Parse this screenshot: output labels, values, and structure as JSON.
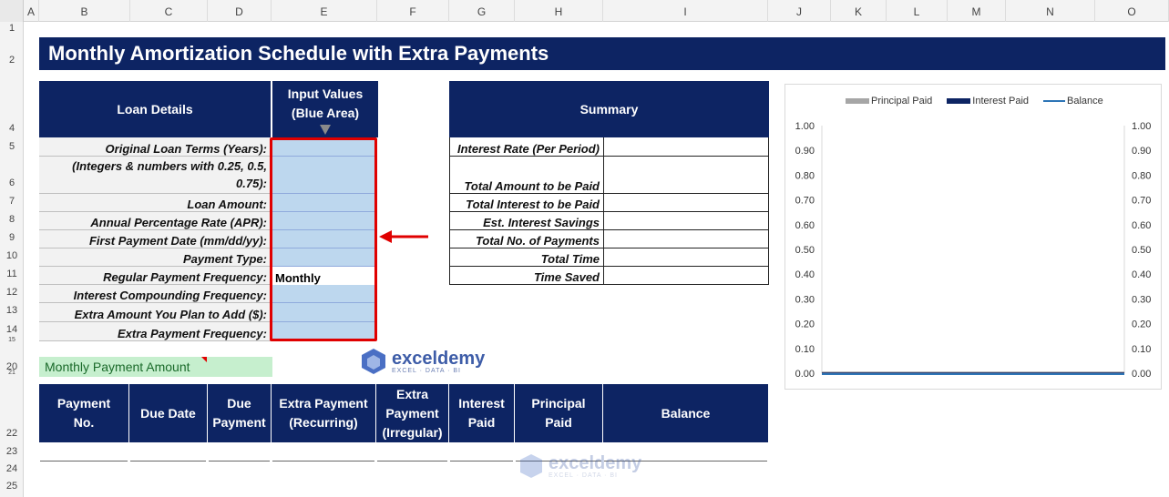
{
  "sheet": {
    "columns": [
      "A",
      "B",
      "C",
      "D",
      "E",
      "F",
      "G",
      "H",
      "I",
      "J",
      "K",
      "L",
      "M",
      "N",
      "O"
    ],
    "rows": [
      "1",
      "2",
      "4",
      "5",
      "6",
      "7",
      "8",
      "9",
      "10",
      "11",
      "12",
      "13",
      "14",
      "15",
      "20",
      "21",
      "22",
      "23",
      "24",
      "25"
    ]
  },
  "title": "Monthly Amortization Schedule with Extra Payments",
  "loan": {
    "header_left": "Loan Details",
    "header_right_line1": "Input Values",
    "header_right_line2": "(Blue Area)",
    "rows": [
      {
        "label": "Original Loan Terms (Years):",
        "value": ""
      },
      {
        "label": "(Integers & numbers with 0.25, 0.5,",
        "label2": "0.75):",
        "value": ""
      },
      {
        "label": "Loan Amount:",
        "value": ""
      },
      {
        "label": "Annual Percentage Rate (APR):",
        "value": ""
      },
      {
        "label": "First Payment Date (mm/dd/yy):",
        "value": ""
      },
      {
        "label": "Payment Type:",
        "value": ""
      },
      {
        "label": "Regular Payment Frequency:",
        "value": "Monthly"
      },
      {
        "label": "Interest Compounding Frequency:",
        "value": ""
      },
      {
        "label": "Extra Amount You Plan to Add ($):",
        "value": ""
      },
      {
        "label": "Extra Payment Frequency:",
        "value": ""
      }
    ]
  },
  "summary": {
    "header": "Summary",
    "rows": [
      {
        "label": "Interest Rate (Per Period)",
        "value": ""
      },
      {
        "label": "Total Amount to be Paid",
        "value": ""
      },
      {
        "label": "Total Interest to be Paid",
        "value": ""
      },
      {
        "label": "Est. Interest Savings",
        "value": ""
      },
      {
        "label": "Total No. of Payments",
        "value": ""
      },
      {
        "label": "Total Time",
        "value": ""
      },
      {
        "label": "Time Saved",
        "value": ""
      }
    ]
  },
  "monthly_payment_label": "Monthly Payment Amount",
  "schedule": {
    "headers": [
      {
        "l1": "Payment",
        "l2": "No."
      },
      {
        "l1": "Due Date",
        "l2": ""
      },
      {
        "l1": "Due",
        "l2": "Payment"
      },
      {
        "l1": "Extra Payment",
        "l2": "(Recurring)"
      },
      {
        "l1": "Extra",
        "l2": "Payment",
        "l3": "(Irregular)"
      },
      {
        "l1": "Interest",
        "l2": "Paid"
      },
      {
        "l1": "Principal",
        "l2": "Paid"
      },
      {
        "l1": "Balance",
        "l2": ""
      }
    ]
  },
  "watermark": {
    "name": "exceldemy",
    "tagline": "EXCEL · DATA · BI"
  },
  "chart_data": {
    "type": "bar",
    "series": [
      {
        "name": "Principal Paid",
        "values": [
          0
        ],
        "color": "#a6a6a6"
      },
      {
        "name": "Interest Paid",
        "values": [
          0
        ],
        "color": "#0d2463"
      },
      {
        "name": "Balance",
        "values": [
          0
        ],
        "color": "#2e75b6"
      }
    ],
    "yticks_left": [
      "1.00",
      "0.90",
      "0.80",
      "0.70",
      "0.60",
      "0.50",
      "0.40",
      "0.30",
      "0.20",
      "0.10",
      "0.00"
    ],
    "yticks_right": [
      "1.00",
      "0.90",
      "0.80",
      "0.70",
      "0.60",
      "0.50",
      "0.40",
      "0.30",
      "0.20",
      "0.10",
      "0.00"
    ],
    "ylim": [
      0,
      1
    ],
    "legend": "top"
  },
  "colors": {
    "header_bg": "#0d2463",
    "input_blue": "#bdd7ee",
    "highlight_red": "#e00000",
    "green_label": "#c6efce"
  }
}
